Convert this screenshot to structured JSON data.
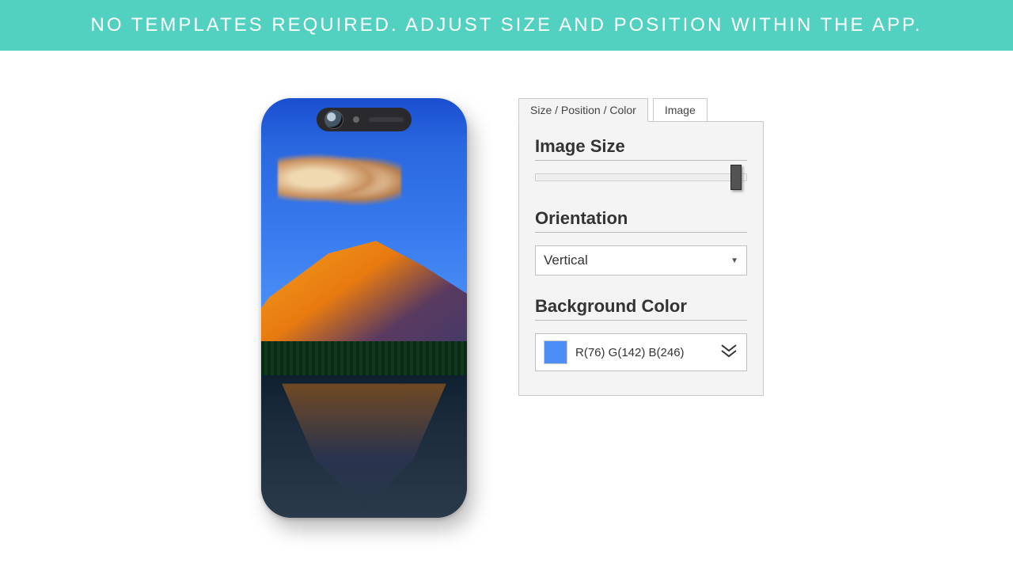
{
  "banner": {
    "text": "NO TEMPLATES REQUIRED. ADJUST SIZE AND POSITION WITHIN THE APP."
  },
  "tabs": {
    "active": "Size / Position / Color",
    "other": "Image"
  },
  "sections": {
    "size_title": "Image Size",
    "orient_title": "Orientation",
    "bg_title": "Background Color"
  },
  "slider": {
    "position_pct": 95
  },
  "orientation": {
    "value": "Vertical"
  },
  "bgcolor": {
    "r": 76,
    "g": 142,
    "b": 246,
    "label": "R(76) G(142) B(246)",
    "hex": "#4c8ef6"
  }
}
